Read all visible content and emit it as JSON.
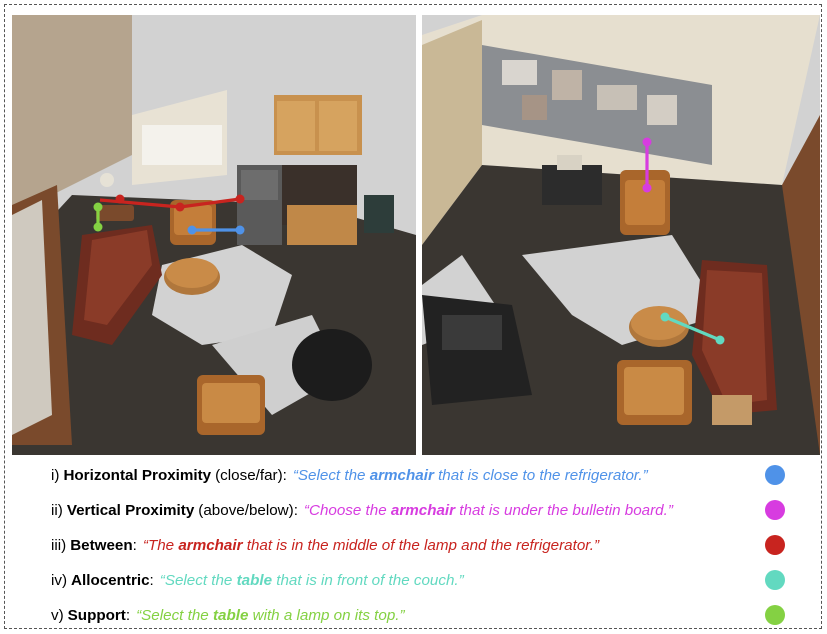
{
  "colors": {
    "horizontal": "#4f92e8",
    "vertical": "#d73ce0",
    "between": "#c8241f",
    "allocentric": "#62d9c0",
    "support": "#84d143"
  },
  "rows": [
    {
      "id": "horizontal",
      "num": "i)",
      "kw": "Horizontal Proximity",
      "qual": "(close/far):",
      "q_pre": "“Select the ",
      "q_obj": "armchair",
      "q_post": " that is close to the refrigerator.”",
      "color_key": "horizontal"
    },
    {
      "id": "vertical",
      "num": "ii)",
      "kw": "Vertical Proximity",
      "qual": "(above/below):",
      "q_pre": "“Choose the ",
      "q_obj": "armchair",
      "q_post": " that is under the bulletin board.”",
      "color_key": "vertical"
    },
    {
      "id": "between",
      "num": "iii)",
      "kw": "Between",
      "qual": ":",
      "q_pre": "“The ",
      "q_obj": "armchair",
      "q_post": " that is in the middle of the lamp and the refrigerator.”",
      "color_key": "between"
    },
    {
      "id": "allocentric",
      "num": "iv)",
      "kw": "Allocentric",
      "qual": ":",
      "q_pre": "“Select the ",
      "q_obj": "table",
      "q_post": " that is in front of the couch.”",
      "color_key": "allocentric"
    },
    {
      "id": "support",
      "num": "v)",
      "kw": "Support",
      "qual": ":",
      "q_pre": "“Select the ",
      "q_obj": "table",
      "q_post": " with a lamp on its top.”",
      "color_key": "support"
    }
  ]
}
